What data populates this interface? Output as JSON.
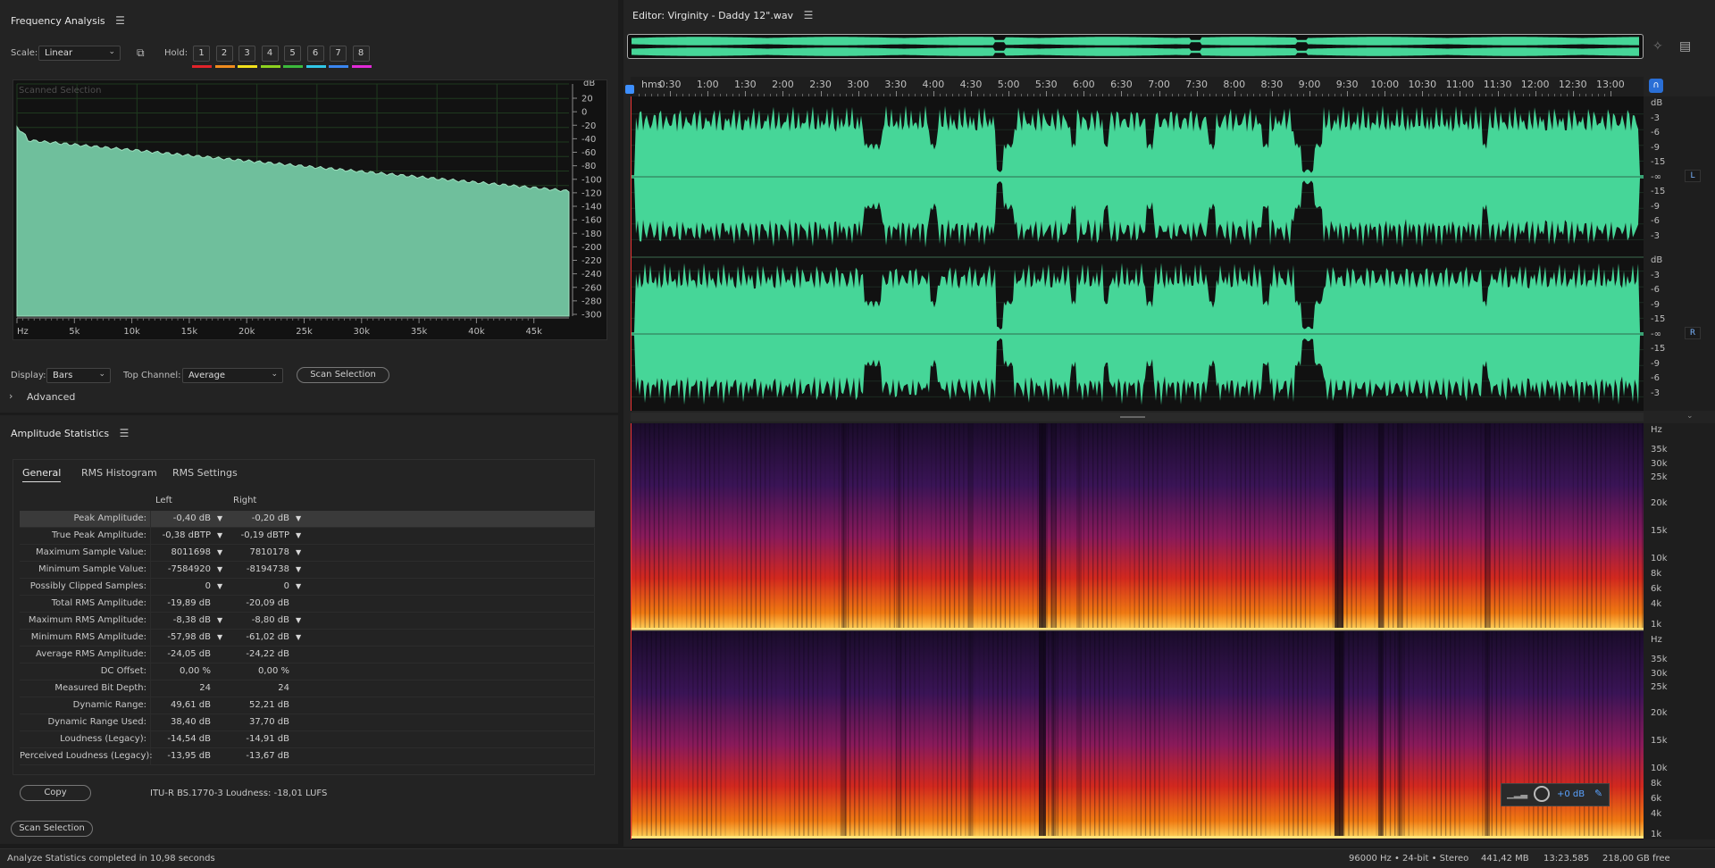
{
  "freq": {
    "title": "Frequency Analysis",
    "scale_label": "Scale:",
    "scale_value": "Linear",
    "hold_label": "Hold:",
    "hold_buttons": [
      "1",
      "2",
      "3",
      "4",
      "5",
      "6",
      "7",
      "8"
    ],
    "hold_colors": [
      "#e2232a",
      "#f08c1e",
      "#f2e11b",
      "#8ed21f",
      "#3cba3c",
      "#31c8e8",
      "#3a86f0",
      "#e22ad8"
    ],
    "plot_watermark": "Scanned Selection",
    "db_unit": "dB",
    "db_ticks": [
      "20",
      "0",
      "-20",
      "-40",
      "-60",
      "-80",
      "-100",
      "-120",
      "-140",
      "-160",
      "-180",
      "-200",
      "-220",
      "-240",
      "-260",
      "-280",
      "-300"
    ],
    "hz_ticks": [
      "Hz",
      "5k",
      "10k",
      "15k",
      "20k",
      "25k",
      "30k",
      "35k",
      "40k",
      "45k"
    ],
    "display_label": "Display:",
    "display_value": "Bars",
    "top_channel_label": "Top Channel:",
    "top_channel_value": "Average",
    "scan_button": "Scan Selection",
    "advanced_label": "Advanced"
  },
  "amp": {
    "title": "Amplitude Statistics",
    "tabs": [
      "General",
      "RMS Histogram",
      "RMS Settings"
    ],
    "col_left": "Left",
    "col_right": "Right",
    "rows": [
      {
        "label": "Peak Amplitude:",
        "left": "-0,40 dB",
        "right": "-0,20 dB",
        "nav": true
      },
      {
        "label": "True Peak Amplitude:",
        "left": "-0,38 dBTP",
        "right": "-0,19 dBTP",
        "nav": true
      },
      {
        "label": "Maximum Sample Value:",
        "left": "8011698",
        "right": "7810178",
        "nav": true
      },
      {
        "label": "Minimum Sample Value:",
        "left": "-7584920",
        "right": "-8194738",
        "nav": true
      },
      {
        "label": "Possibly Clipped Samples:",
        "left": "0",
        "right": "0",
        "nav": true
      },
      {
        "label": "Total RMS Amplitude:",
        "left": "-19,89 dB",
        "right": "-20,09 dB",
        "nav": false
      },
      {
        "label": "Maximum RMS Amplitude:",
        "left": "-8,38 dB",
        "right": "-8,80 dB",
        "nav": true
      },
      {
        "label": "Minimum RMS Amplitude:",
        "left": "-57,98 dB",
        "right": "-61,02 dB",
        "nav": true
      },
      {
        "label": "Average RMS Amplitude:",
        "left": "-24,05 dB",
        "right": "-24,22 dB",
        "nav": false
      },
      {
        "label": "DC Offset:",
        "left": "0,00 %",
        "right": "0,00 %",
        "nav": false
      },
      {
        "label": "Measured Bit Depth:",
        "left": "24",
        "right": "24",
        "nav": false
      },
      {
        "label": "Dynamic Range:",
        "left": "49,61 dB",
        "right": "52,21 dB",
        "nav": false
      },
      {
        "label": "Dynamic Range Used:",
        "left": "38,40 dB",
        "right": "37,70 dB",
        "nav": false
      },
      {
        "label": "Loudness (Legacy):",
        "left": "-14,54 dB",
        "right": "-14,91 dB",
        "nav": false
      },
      {
        "label": "Perceived Loudness (Legacy):",
        "left": "-13,95 dB",
        "right": "-13,67 dB",
        "nav": false
      }
    ],
    "copy_button": "Copy",
    "itu_text": "ITU-R BS.1770-3 Loudness: -18,01 LUFS",
    "scan_button": "Scan Selection"
  },
  "editor": {
    "title": "Editor: Virginity - Daddy 12\".wav",
    "ruler_unit": "hms",
    "ruler_ticks": [
      "0:30",
      "1:00",
      "1:30",
      "2:00",
      "2:30",
      "3:00",
      "3:30",
      "4:00",
      "4:30",
      "5:00",
      "5:30",
      "6:00",
      "6:30",
      "7:00",
      "7:30",
      "8:00",
      "8:30",
      "9:00",
      "9:30",
      "10:00",
      "10:30",
      "11:00",
      "11:30",
      "12:00",
      "12:30",
      "13:00"
    ],
    "db_scale": [
      "dB",
      "-3",
      "-6",
      "-9",
      "-15",
      "-∞",
      "-15",
      "-9",
      "-6",
      "-3"
    ],
    "hz_scale": [
      "Hz",
      "35k",
      "30k",
      "25k",
      "20k",
      "15k",
      "10k",
      "8k",
      "6k",
      "4k",
      "1k"
    ],
    "channel_left": "L",
    "channel_right": "R",
    "hud_gain": "+0 dB",
    "wave_color": "#46d698"
  },
  "status": {
    "message": "Analyze Statistics completed in 10,98 seconds",
    "format": "96000 Hz • 24-bit • Stereo",
    "size": "441,42 MB",
    "duration": "13:23.585",
    "free": "218,00 GB free"
  }
}
